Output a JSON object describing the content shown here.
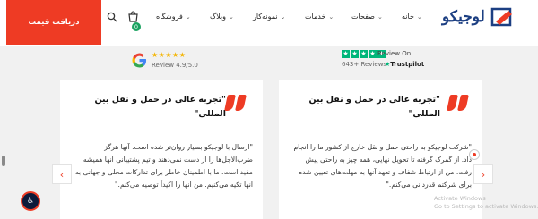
{
  "header": {
    "quote_button": "دریافت قیمت",
    "cart_count": "0",
    "menu": [
      {
        "label": "خانه",
        "has_dropdown": true
      },
      {
        "label": "صفحات",
        "has_dropdown": true
      },
      {
        "label": "خدمات",
        "has_dropdown": true
      },
      {
        "label": "نمونه‌کار",
        "has_dropdown": true
      },
      {
        "label": "وبلاگ",
        "has_dropdown": true
      },
      {
        "label": "فروشگاه",
        "has_dropdown": true
      }
    ],
    "logo_text": "لوجیکو",
    "icons": [
      "search-icon",
      "cart-icon",
      "logo-mark-icon"
    ]
  },
  "reviews": {
    "google": {
      "rating_text": "Review 4.9/5.0",
      "stars": 5
    },
    "trustpilot": {
      "label": "Review On",
      "count_text": "643+ Reviews",
      "brand": "Trustpilot",
      "stars": 5
    }
  },
  "testimonials": [
    {
      "title": "\"تجربه عالی در حمل و نقل بین المللی\"",
      "body": "\"شرکت لوجیکو به راحتی حمل و نقل خارج از کشور ما را انجام داد. از گمرک گرفته تا تحویل نهایی، همه چیز به راحتی پیش رفت. من از ارتباط شفاف و تعهد آنها به مهلت‌های تعیین شده برای شرکتم قدردانی می‌کنم.\""
    },
    {
      "title": "\"تجربه عالی در حمل و نقل بین المللی\"",
      "body": "\"ارسال با لوجیکو بسیار روان‌تر شده است. آنها هرگز ضرب‌الاجل‌ها را از دست نمی‌دهند و تیم پشتیبانی آنها همیشه مفید است. ما با اطمینان خاطر برای تدارکات محلی و جهانی به آنها تکیه می‌کنیم. من آنها را اکیداً توصیه می‌کنم.\""
    }
  ],
  "watermark": {
    "line1": "Activate Windows",
    "line2": "Go to Settings to activate Windows."
  },
  "colors": {
    "accent": "#ee3b24",
    "brand": "#1c3f82",
    "google_star": "#f4b400",
    "trustpilot": "#00b67a"
  }
}
